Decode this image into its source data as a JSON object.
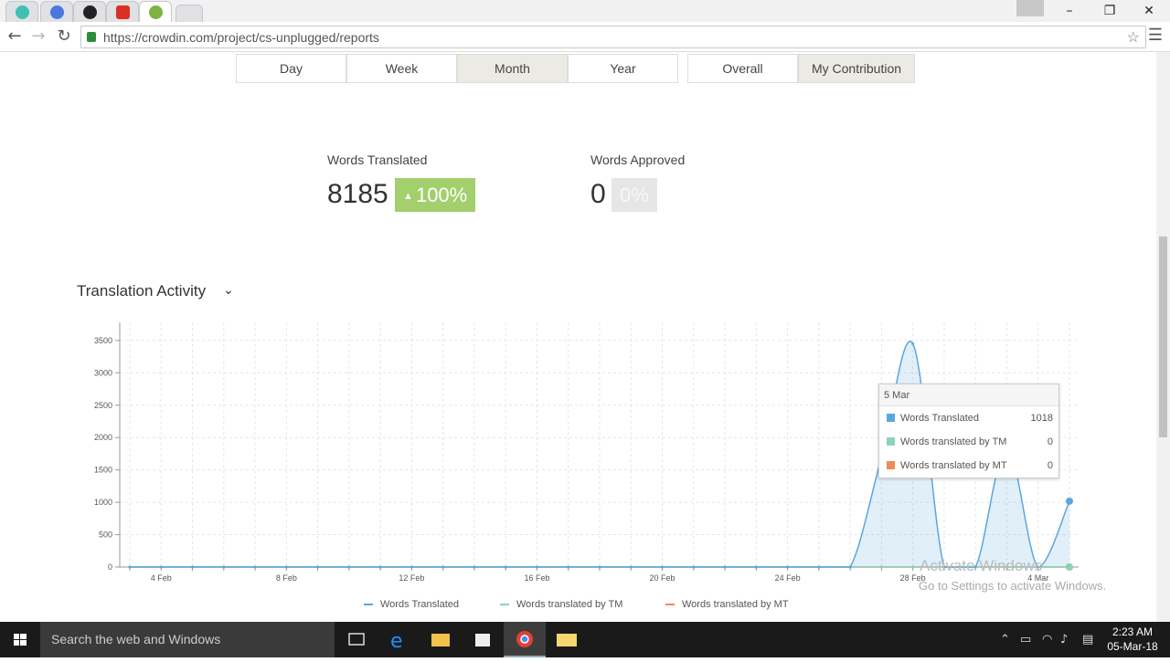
{
  "browser": {
    "url": "https://crowdin.com/project/cs-unplugged/reports",
    "tabs": [
      {
        "icon": "chrome-app-icon",
        "color": "#3ec1b0",
        "active": false
      },
      {
        "icon": "app-icon",
        "color": "#4a78e0",
        "active": false
      },
      {
        "icon": "github-icon",
        "color": "#222222",
        "active": false
      },
      {
        "icon": "app-icon",
        "color": "#d93025",
        "active": false
      },
      {
        "icon": "crowdin-icon",
        "color": "#7cb342",
        "active": true
      },
      {
        "icon": "new-tab",
        "color": "#dfe1e5",
        "active": false
      }
    ]
  },
  "period_tabs": [
    {
      "label": "Day",
      "selected": false
    },
    {
      "label": "Week",
      "selected": false
    },
    {
      "label": "Month",
      "selected": true
    },
    {
      "label": "Year",
      "selected": false
    }
  ],
  "scope_tabs": [
    {
      "label": "Overall",
      "selected": false
    },
    {
      "label": "My Contribution",
      "selected": true
    }
  ],
  "stats": {
    "translated": {
      "label": "Words Translated",
      "value": "8185",
      "change": "100%",
      "color": "#a3cf6c"
    },
    "approved": {
      "label": "Words Approved",
      "value": "0",
      "change": "0%",
      "color": "#e6e6e6"
    }
  },
  "activity": {
    "title": "Translation Activity"
  },
  "chart_data": {
    "type": "area",
    "ylim": [
      0,
      3500
    ],
    "yticks": [
      "0",
      "500",
      "1000",
      "1500",
      "2000",
      "2500",
      "3000",
      "3500"
    ],
    "x": [
      "3 Feb",
      "4 Feb",
      "5 Feb",
      "6 Feb",
      "7 Feb",
      "8 Feb",
      "9 Feb",
      "10 Feb",
      "11 Feb",
      "12 Feb",
      "13 Feb",
      "14 Feb",
      "15 Feb",
      "16 Feb",
      "17 Feb",
      "18 Feb",
      "19 Feb",
      "20 Feb",
      "21 Feb",
      "22 Feb",
      "23 Feb",
      "24 Feb",
      "25 Feb",
      "26 Feb",
      "27 Feb",
      "28 Feb",
      "1 Mar",
      "2 Mar",
      "3 Mar",
      "4 Mar",
      "5 Mar"
    ],
    "xtick_labels": [
      "4 Feb",
      "8 Feb",
      "12 Feb",
      "16 Feb",
      "20 Feb",
      "24 Feb",
      "28 Feb",
      "4 Mar"
    ],
    "series": [
      {
        "name": "Words Translated",
        "color": "#5aa7de",
        "values": [
          0,
          0,
          0,
          0,
          0,
          0,
          0,
          0,
          0,
          0,
          0,
          0,
          0,
          0,
          0,
          0,
          0,
          0,
          0,
          0,
          0,
          0,
          0,
          0,
          1700,
          3450,
          0,
          0,
          1850,
          0,
          1018
        ]
      },
      {
        "name": "Words translated by TM",
        "color": "#8dd3b7",
        "values": [
          0,
          0,
          0,
          0,
          0,
          0,
          0,
          0,
          0,
          0,
          0,
          0,
          0,
          0,
          0,
          0,
          0,
          0,
          0,
          0,
          0,
          0,
          0,
          0,
          0,
          0,
          0,
          0,
          0,
          0,
          0
        ]
      },
      {
        "name": "Words translated by MT",
        "color": "#ef8a5a",
        "values": [
          0,
          0,
          0,
          0,
          0,
          0,
          0,
          0,
          0,
          0,
          0,
          0,
          0,
          0,
          0,
          0,
          0,
          0,
          0,
          0,
          0,
          0,
          0,
          0,
          0,
          0,
          0,
          0,
          0,
          0,
          0
        ]
      }
    ]
  },
  "tooltip": {
    "date": "5 Mar",
    "rows": [
      {
        "label": "Words Translated",
        "value": "1018",
        "color": "#5aa7de"
      },
      {
        "label": "Words translated by TM",
        "value": "0",
        "color": "#8dd3b7"
      },
      {
        "label": "Words translated by MT",
        "value": "0",
        "color": "#ef8a5a"
      }
    ]
  },
  "watermark": {
    "line1": "Activate Windows",
    "line2": "Go to Settings to activate Windows."
  },
  "taskbar": {
    "search_placeholder": "Search the web and Windows",
    "time": "2:23 AM",
    "date": "05-Mar-18"
  }
}
